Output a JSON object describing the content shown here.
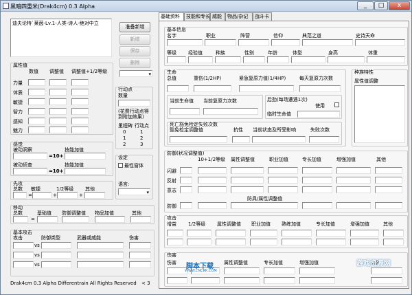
{
  "window": {
    "title": "黑暗四重米(Drak4cm)  0.3 Alpha",
    "minimize": "_",
    "maximize": "□",
    "close": "x"
  },
  "left": {
    "description": "迪夫论特`莱茵-Lv.1-人类-诗人-绝对中立",
    "buttons": {
      "new": "准备新增",
      "add": "新增",
      "save": "保存",
      "delete": "删除"
    },
    "attributes": {
      "title": "属性值",
      "col_value": "数值",
      "col_adjust": "调整值",
      "col_adj_bonus": "调整值+1/2等级",
      "rows": [
        "力量",
        "体质",
        "敏捷",
        "智力",
        "感知",
        "魅力"
      ]
    },
    "perception": {
      "title": "感觉",
      "passive_detect": "被动洞察",
      "passive_insight": "被动侦查",
      "skill_bonus": "技能加值",
      "base": "=10+"
    },
    "initiative": {
      "title": "先攻",
      "total": "总数",
      "dex": "敏捷",
      "half_level": "1/2等级",
      "other": "其他",
      "eq": "=",
      "plus": "+"
    },
    "movement": {
      "title": "移动",
      "total": "总数",
      "base": "基础值",
      "armor": "防御调整值",
      "item": "物品加值",
      "other": "其他",
      "eq": "="
    },
    "basic_attack": {
      "title": "基本攻击",
      "attack": "攻击",
      "defense_type": "防御类型",
      "weapon": "武器或威能",
      "damage": "伤害",
      "vs": "vs"
    },
    "action_points": {
      "title": "行动点",
      "count": "数量",
      "note": "(花费行动点得到附加效果)",
      "milestone": "里程碑",
      "ap": "行动点",
      "rows": [
        [
          "0",
          "1"
        ],
        [
          "1",
          "2"
        ],
        [
          "2",
          "3"
        ]
      ]
    },
    "settings": {
      "title": "设定",
      "topmost": "最性窗体",
      "language": "语言:"
    },
    "footer": "Drak4cm 0.3 Alpha Differentrain All Rights Reserved",
    "page": "< 3"
  },
  "tabs": [
    "基础资料",
    "技能和专长",
    "威能",
    "物品/杂记",
    "战斗卡"
  ],
  "main": {
    "basic": {
      "title": "基本信息",
      "name": "名字",
      "class": "职业",
      "faction": "阵营",
      "deity": "信仰",
      "paragon": "典范之道",
      "epic": "史诗天命",
      "level": "等级",
      "xp": "经验值",
      "race": "种族",
      "gender": "性别",
      "age": "年龄",
      "build": "体型",
      "height": "身高",
      "weight": "体重"
    },
    "hp": {
      "title": "生命",
      "total": "总值",
      "bloodied": "重伤(1/2HP)",
      "surge": "紧急复原力值(1/4HP)",
      "surges_day": "每天复原力次数",
      "current": "当前生命值",
      "current_surges": "当前复原力次数",
      "second_wind": "后劲(每场遭遇1次)",
      "used": "使用",
      "temp_hp": "临时生命值",
      "death_saves": "死亡豁免检定失败次数",
      "save_adj": "豁免检定调整值",
      "resist": "抗性",
      "status": "当前状态及所受影响",
      "fails": "失败次数"
    },
    "racial": {
      "title": "种族特性",
      "attr_adj": "属性值调整"
    },
    "defense": {
      "title": "防御(状况调整值)",
      "base": "10+1/2等级",
      "attr": "属性调整值",
      "class": "职业加值",
      "feat": "专长加值",
      "enh": "增强加值",
      "other": "其他",
      "rows": [
        "闪避",
        "反射",
        "意志",
        "防御"
      ],
      "armor_attr": "防具/属性调整值"
    },
    "attack": {
      "title": "攻击",
      "bonus": "增益",
      "half_level": "1/2等级",
      "attr": "属性调整值",
      "class": "职业加值",
      "proficiency": "熟练加值",
      "feat": "专长加值",
      "enh": "增强加值",
      "other": "其他"
    },
    "damage": {
      "title": "伤害",
      "label": "伤害",
      "attr": "属性调整值",
      "feat": "专长加值",
      "enh": "增强加值",
      "other": "其他"
    }
  },
  "watermarks": {
    "left": "脚本下载",
    "left_sub": "WWW.CNCRK.COM",
    "right": "游戏资源网"
  }
}
